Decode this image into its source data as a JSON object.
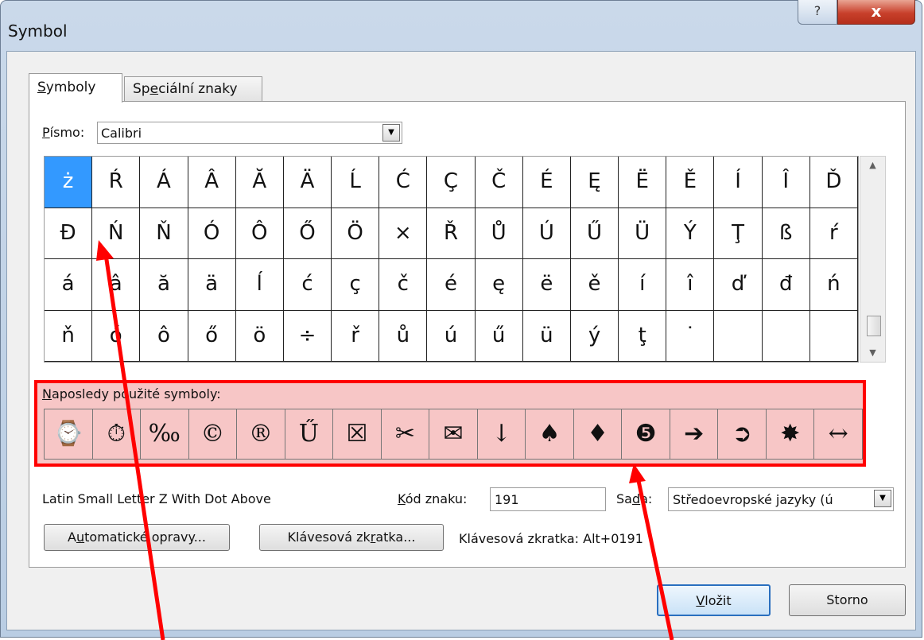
{
  "window": {
    "title": "Symbol",
    "help_label": "?",
    "close_label": "x"
  },
  "tabs": [
    {
      "underline": "S",
      "rest": "ymboly"
    },
    {
      "pre": "Sp",
      "underline": "e",
      "rest": "ciální znaky"
    }
  ],
  "font": {
    "label_underline": "P",
    "label_rest": "ísmo:",
    "value": "Calibri"
  },
  "symbol_grid": [
    [
      "ż",
      "Ŕ",
      "Á",
      "Â",
      "Ă",
      "Ä",
      "Ĺ",
      "Ć",
      "Ç",
      "Č",
      "É",
      "Ę",
      "Ë",
      "Ě",
      "Í",
      "Î",
      "Ď"
    ],
    [
      "Đ",
      "Ń",
      "Ň",
      "Ó",
      "Ô",
      "Ő",
      "Ö",
      "×",
      "Ř",
      "Ů",
      "Ú",
      "Ű",
      "Ü",
      "Ý",
      "Ţ",
      "ß",
      "ŕ"
    ],
    [
      "á",
      "â",
      "ă",
      "ä",
      "ĺ",
      "ć",
      "ç",
      "č",
      "é",
      "ę",
      "ë",
      "ě",
      "í",
      "î",
      "ď",
      "đ",
      "ń"
    ],
    [
      "ň",
      "ó",
      "ô",
      "ő",
      "ö",
      "÷",
      "ř",
      "ů",
      "ú",
      "ű",
      "ü",
      "ý",
      "ţ",
      "˙",
      "",
      "",
      ""
    ]
  ],
  "recent": {
    "label_underline": "N",
    "label_rest": "aposledy použité symboly:",
    "symbols": [
      "⌚",
      "⏱",
      "‰",
      "©",
      "®",
      "Ű",
      "☒",
      "✂",
      "✉",
      "↓",
      "♠",
      "♦",
      "❺",
      "➔",
      "➲",
      "✸",
      "↔"
    ]
  },
  "char_info": {
    "name": "Latin Small Letter Z With Dot Above",
    "code_label_underline": "K",
    "code_label_rest": "ód znaku:",
    "code_value": "191",
    "set_label_pre": "Sa",
    "set_label_underline": "d",
    "set_label_rest": "a:",
    "set_value": "Středoevropské jazyky (ú"
  },
  "buttons": {
    "autocorrect_pre": "A",
    "autocorrect_underline": "u",
    "autocorrect_rest": "tomatické opravy...",
    "shortcut_pre": "Klávesová zk",
    "shortcut_underline": "r",
    "shortcut_rest": "atka...",
    "insert_underline": "V",
    "insert_rest": "ložit",
    "cancel": "Storno"
  },
  "shortcut_info": "Klávesová zkratka: Alt+0191",
  "colors": {
    "highlight": "#ff0000",
    "selection": "#3399ff",
    "recent_bg": "#f7c6c6"
  }
}
